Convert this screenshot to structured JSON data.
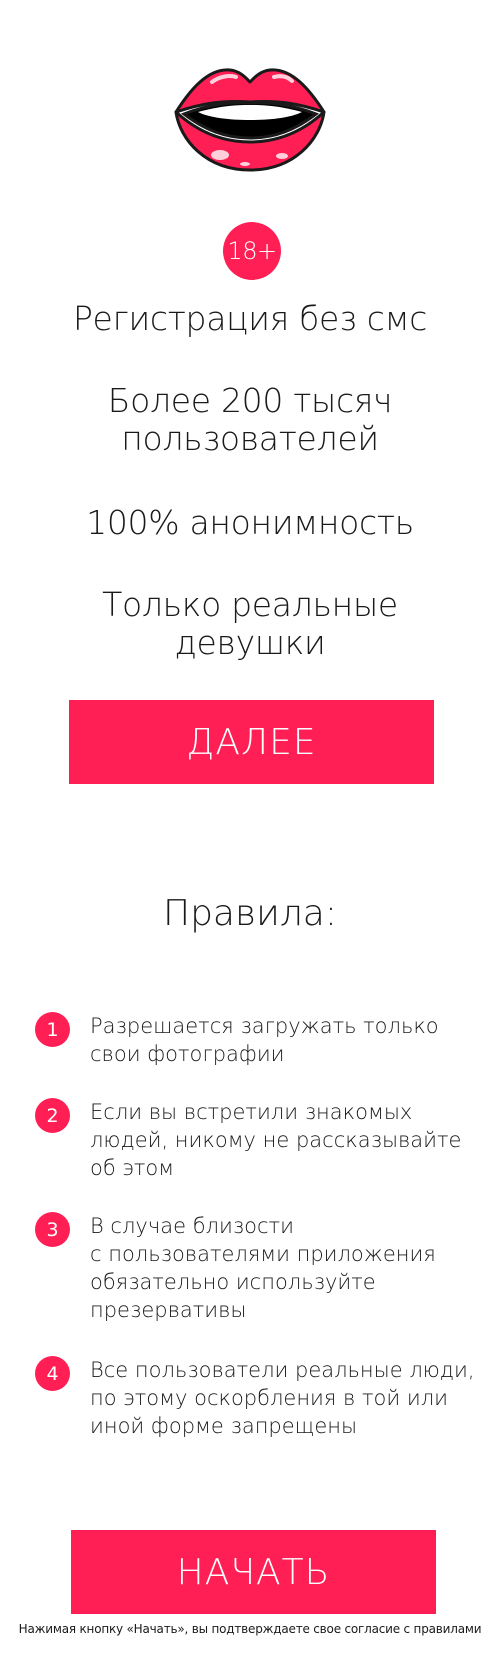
{
  "logo": {
    "icon": "lips-icon",
    "colors": {
      "lip": "#ff1f55",
      "outline": "#1a1a1a",
      "mouth": "#000000",
      "teeth": "#ffffff"
    }
  },
  "badge": {
    "label": "18+"
  },
  "features": [
    "Регистрация без смс",
    "Более 200 тысяч\nпользователей",
    "100% анонимность",
    "Только реальные\nдевушки"
  ],
  "next_button": {
    "label": "ДАЛЕЕ"
  },
  "rules": {
    "title": "Правила:",
    "items": [
      {
        "num": "1",
        "text": "Разрешается загружать только\nсвои фотографии"
      },
      {
        "num": "2",
        "text": "Если вы встретили знакомых\nлюдей, никому не рассказывайте\nоб этом"
      },
      {
        "num": "3",
        "text": "В случае близости\nс пользователями приложения\nобязательно используйте\nпрезервативы"
      },
      {
        "num": "4",
        "text": "Все пользователи реальные люди,\nпо этому оскорбления в той или\nиной форме запрещены"
      }
    ]
  },
  "start_button": {
    "label": "НАЧАТЬ"
  },
  "consent_text": "Нажимая кнопку «Начать», вы подтверждаете свое согласие с правилами",
  "colors": {
    "accent": "#ff1f55",
    "text": "#1a1a1a",
    "background": "#ffffff"
  }
}
